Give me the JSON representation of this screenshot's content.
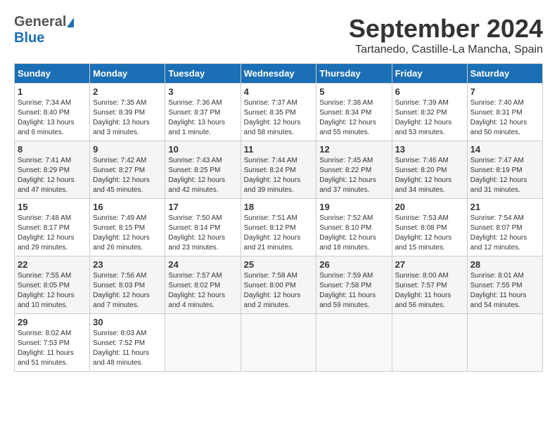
{
  "header": {
    "logo_general": "General",
    "logo_blue": "Blue",
    "month_title": "September 2024",
    "location": "Tartanedo, Castille-La Mancha, Spain"
  },
  "days_of_week": [
    "Sunday",
    "Monday",
    "Tuesday",
    "Wednesday",
    "Thursday",
    "Friday",
    "Saturday"
  ],
  "weeks": [
    [
      {
        "day": "1",
        "sunrise": "Sunrise: 7:34 AM",
        "sunset": "Sunset: 8:40 PM",
        "daylight": "Daylight: 13 hours and 6 minutes."
      },
      {
        "day": "2",
        "sunrise": "Sunrise: 7:35 AM",
        "sunset": "Sunset: 8:39 PM",
        "daylight": "Daylight: 13 hours and 3 minutes."
      },
      {
        "day": "3",
        "sunrise": "Sunrise: 7:36 AM",
        "sunset": "Sunset: 8:37 PM",
        "daylight": "Daylight: 13 hours and 1 minute."
      },
      {
        "day": "4",
        "sunrise": "Sunrise: 7:37 AM",
        "sunset": "Sunset: 8:35 PM",
        "daylight": "Daylight: 12 hours and 58 minutes."
      },
      {
        "day": "5",
        "sunrise": "Sunrise: 7:38 AM",
        "sunset": "Sunset: 8:34 PM",
        "daylight": "Daylight: 12 hours and 55 minutes."
      },
      {
        "day": "6",
        "sunrise": "Sunrise: 7:39 AM",
        "sunset": "Sunset: 8:32 PM",
        "daylight": "Daylight: 12 hours and 53 minutes."
      },
      {
        "day": "7",
        "sunrise": "Sunrise: 7:40 AM",
        "sunset": "Sunset: 8:31 PM",
        "daylight": "Daylight: 12 hours and 50 minutes."
      }
    ],
    [
      {
        "day": "8",
        "sunrise": "Sunrise: 7:41 AM",
        "sunset": "Sunset: 8:29 PM",
        "daylight": "Daylight: 12 hours and 47 minutes."
      },
      {
        "day": "9",
        "sunrise": "Sunrise: 7:42 AM",
        "sunset": "Sunset: 8:27 PM",
        "daylight": "Daylight: 12 hours and 45 minutes."
      },
      {
        "day": "10",
        "sunrise": "Sunrise: 7:43 AM",
        "sunset": "Sunset: 8:25 PM",
        "daylight": "Daylight: 12 hours and 42 minutes."
      },
      {
        "day": "11",
        "sunrise": "Sunrise: 7:44 AM",
        "sunset": "Sunset: 8:24 PM",
        "daylight": "Daylight: 12 hours and 39 minutes."
      },
      {
        "day": "12",
        "sunrise": "Sunrise: 7:45 AM",
        "sunset": "Sunset: 8:22 PM",
        "daylight": "Daylight: 12 hours and 37 minutes."
      },
      {
        "day": "13",
        "sunrise": "Sunrise: 7:46 AM",
        "sunset": "Sunset: 8:20 PM",
        "daylight": "Daylight: 12 hours and 34 minutes."
      },
      {
        "day": "14",
        "sunrise": "Sunrise: 7:47 AM",
        "sunset": "Sunset: 8:19 PM",
        "daylight": "Daylight: 12 hours and 31 minutes."
      }
    ],
    [
      {
        "day": "15",
        "sunrise": "Sunrise: 7:48 AM",
        "sunset": "Sunset: 8:17 PM",
        "daylight": "Daylight: 12 hours and 29 minutes."
      },
      {
        "day": "16",
        "sunrise": "Sunrise: 7:49 AM",
        "sunset": "Sunset: 8:15 PM",
        "daylight": "Daylight: 12 hours and 26 minutes."
      },
      {
        "day": "17",
        "sunrise": "Sunrise: 7:50 AM",
        "sunset": "Sunset: 8:14 PM",
        "daylight": "Daylight: 12 hours and 23 minutes."
      },
      {
        "day": "18",
        "sunrise": "Sunrise: 7:51 AM",
        "sunset": "Sunset: 8:12 PM",
        "daylight": "Daylight: 12 hours and 21 minutes."
      },
      {
        "day": "19",
        "sunrise": "Sunrise: 7:52 AM",
        "sunset": "Sunset: 8:10 PM",
        "daylight": "Daylight: 12 hours and 18 minutes."
      },
      {
        "day": "20",
        "sunrise": "Sunrise: 7:53 AM",
        "sunset": "Sunset: 8:08 PM",
        "daylight": "Daylight: 12 hours and 15 minutes."
      },
      {
        "day": "21",
        "sunrise": "Sunrise: 7:54 AM",
        "sunset": "Sunset: 8:07 PM",
        "daylight": "Daylight: 12 hours and 12 minutes."
      }
    ],
    [
      {
        "day": "22",
        "sunrise": "Sunrise: 7:55 AM",
        "sunset": "Sunset: 8:05 PM",
        "daylight": "Daylight: 12 hours and 10 minutes."
      },
      {
        "day": "23",
        "sunrise": "Sunrise: 7:56 AM",
        "sunset": "Sunset: 8:03 PM",
        "daylight": "Daylight: 12 hours and 7 minutes."
      },
      {
        "day": "24",
        "sunrise": "Sunrise: 7:57 AM",
        "sunset": "Sunset: 8:02 PM",
        "daylight": "Daylight: 12 hours and 4 minutes."
      },
      {
        "day": "25",
        "sunrise": "Sunrise: 7:58 AM",
        "sunset": "Sunset: 8:00 PM",
        "daylight": "Daylight: 12 hours and 2 minutes."
      },
      {
        "day": "26",
        "sunrise": "Sunrise: 7:59 AM",
        "sunset": "Sunset: 7:58 PM",
        "daylight": "Daylight: 11 hours and 59 minutes."
      },
      {
        "day": "27",
        "sunrise": "Sunrise: 8:00 AM",
        "sunset": "Sunset: 7:57 PM",
        "daylight": "Daylight: 11 hours and 56 minutes."
      },
      {
        "day": "28",
        "sunrise": "Sunrise: 8:01 AM",
        "sunset": "Sunset: 7:55 PM",
        "daylight": "Daylight: 11 hours and 54 minutes."
      }
    ],
    [
      {
        "day": "29",
        "sunrise": "Sunrise: 8:02 AM",
        "sunset": "Sunset: 7:53 PM",
        "daylight": "Daylight: 11 hours and 51 minutes."
      },
      {
        "day": "30",
        "sunrise": "Sunrise: 8:03 AM",
        "sunset": "Sunset: 7:52 PM",
        "daylight": "Daylight: 11 hours and 48 minutes."
      },
      null,
      null,
      null,
      null,
      null
    ]
  ]
}
